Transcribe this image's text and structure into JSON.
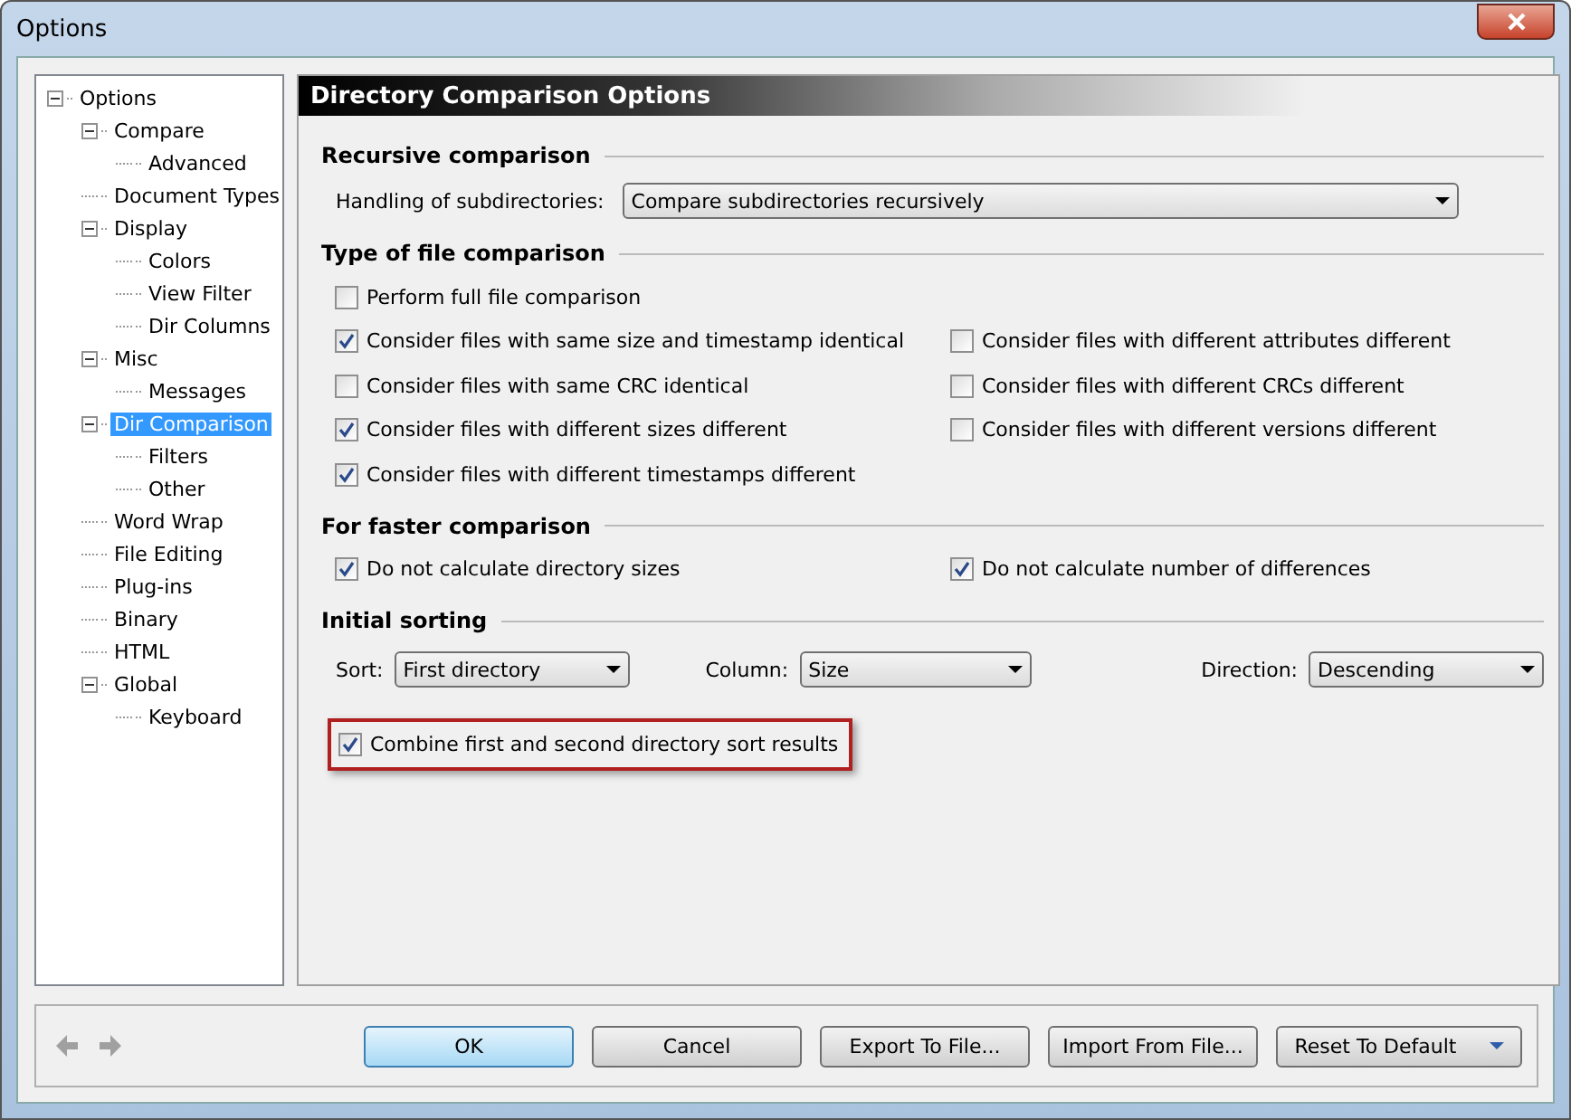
{
  "window": {
    "title": "Options"
  },
  "tree": [
    {
      "label": "Options",
      "selected": false,
      "expanded": true,
      "children": [
        {
          "label": "Compare",
          "selected": false,
          "expanded": true,
          "children": [
            {
              "label": "Advanced",
              "selected": false
            }
          ]
        },
        {
          "label": "Document Types",
          "selected": false
        },
        {
          "label": "Display",
          "selected": false,
          "expanded": true,
          "children": [
            {
              "label": "Colors",
              "selected": false
            },
            {
              "label": "View Filter",
              "selected": false
            },
            {
              "label": "Dir Columns",
              "selected": false
            }
          ]
        },
        {
          "label": "Misc",
          "selected": false,
          "expanded": true,
          "children": [
            {
              "label": "Messages",
              "selected": false
            }
          ]
        },
        {
          "label": "Dir Comparison",
          "selected": true,
          "expanded": true,
          "children": [
            {
              "label": "Filters",
              "selected": false
            },
            {
              "label": "Other",
              "selected": false
            }
          ]
        },
        {
          "label": "Word Wrap",
          "selected": false
        },
        {
          "label": "File Editing",
          "selected": false
        },
        {
          "label": "Plug-ins",
          "selected": false
        },
        {
          "label": "Binary",
          "selected": false
        },
        {
          "label": "HTML",
          "selected": false
        },
        {
          "label": "Global",
          "selected": false,
          "expanded": true,
          "children": [
            {
              "label": "Keyboard",
              "selected": false
            }
          ]
        }
      ]
    }
  ],
  "page_title": "Directory Comparison Options",
  "sections": [
    {
      "kind": "select",
      "title": "Recursive comparison",
      "label": "Handling of subdirectories:",
      "value": "Compare subdirectories recursively"
    },
    {
      "kind": "checks",
      "title": "Type of file comparison",
      "left": [
        {
          "label": "Perform full file comparison",
          "checked": false
        },
        {
          "label": "Consider files with same size and timestamp identical",
          "checked": true
        },
        {
          "label": "Consider files with same CRC identical",
          "checked": false
        },
        {
          "label": "Consider files with different sizes different",
          "checked": true
        },
        {
          "label": "Consider files with different timestamps different",
          "checked": true
        }
      ],
      "right": [
        {
          "label": "Consider files with different attributes different",
          "checked": false
        },
        {
          "label": "Consider files with different CRCs different",
          "checked": false
        },
        {
          "label": "Consider files with different versions different",
          "checked": false
        }
      ]
    },
    {
      "kind": "checks",
      "title": "For faster comparison",
      "left": [
        {
          "label": "Do not calculate directory sizes",
          "checked": true
        }
      ],
      "right": [
        {
          "label": "Do not calculate number of differences",
          "checked": true
        }
      ]
    },
    {
      "kind": "sort",
      "title": "Initial sorting",
      "selects": [
        {
          "label": "Sort:",
          "value": "First directory"
        },
        {
          "label": "Column:",
          "value": "Size"
        },
        {
          "label": "Direction:",
          "value": "Descending"
        }
      ],
      "highlighted": {
        "label": "Combine first and second directory sort results",
        "checked": true
      }
    }
  ],
  "buttons": [
    {
      "label": "OK",
      "default": true
    },
    {
      "label": "Cancel",
      "default": false
    },
    {
      "label": "Export To File...",
      "default": false
    },
    {
      "label": "Import From File...",
      "default": false
    }
  ],
  "split_button": {
    "label": "Reset To Default"
  }
}
